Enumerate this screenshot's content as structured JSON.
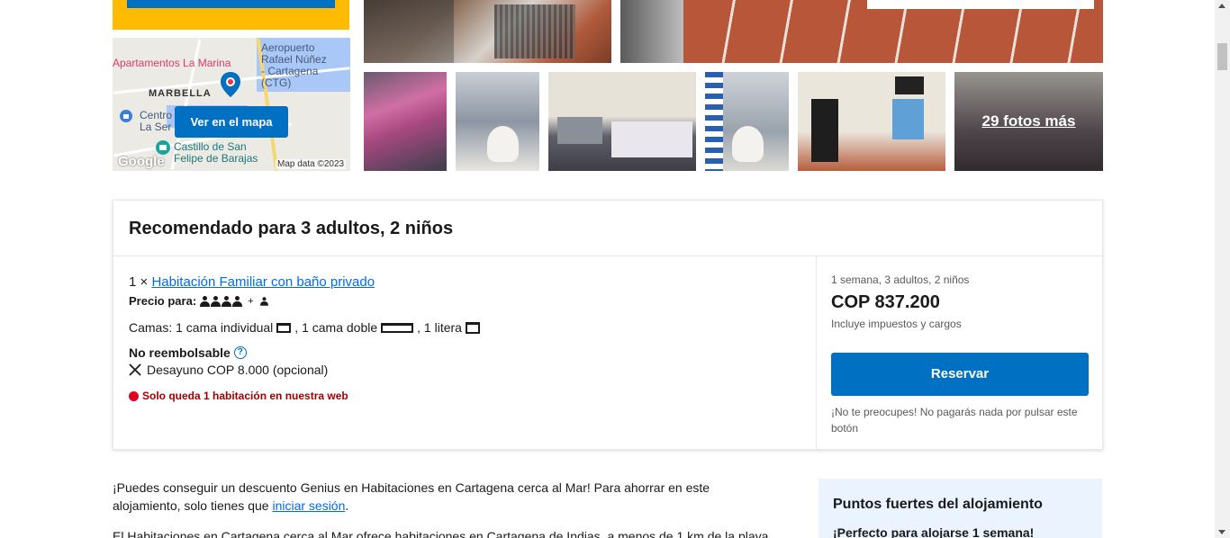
{
  "map": {
    "labels": {
      "hotel": "Apartamentos La Marina",
      "airport": "Aeropuerto\nRafael Núñez\n- Cartagena\n(CTG)",
      "marbella": "MARBELLA",
      "centro": "Centro\nLa Ser",
      "castillo": "Castillo de San\nFelipe de Barajas"
    },
    "button_label": "Ver en el mapa",
    "google": "Google",
    "map_data": "Map data ©2023"
  },
  "photos": {
    "more_label": "29 fotos más"
  },
  "recommendation": {
    "title": "Recomendado para 3 adultos, 2 niños",
    "room_count": "1 ×",
    "room_name": "Habitación Familiar con baño privado",
    "price_for_label": "Precio para:",
    "adults_icons": 4,
    "children_icons": 1,
    "beds_label": "Camas: 1 cama individual",
    "bed_double": ", 1 cama doble",
    "bed_bunk": ", 1 litera",
    "non_refundable": "No reembolsable",
    "breakfast": "Desayuno COP 8.000 (opcional)",
    "scarcity": "Solo queda 1 habitación en nuestra web",
    "stay_info": "1 semana, 3 adultos, 2 niños",
    "price": "COP 837.200",
    "taxes": "Incluye impuestos y cargos",
    "reserve_label": "Reservar",
    "dont_worry": "¡No te preocupes! No pagarás nada por pulsar este botón"
  },
  "description": {
    "line1_prefix": "¡Puedes conseguir un descuento Genius en Habitaciones en Cartagena cerca al Mar! Para ahorrar en este alojamiento, solo tienes que ",
    "login_link": "iniciar sesión",
    "line1_suffix": ".",
    "line2": "El Habitaciones en Cartagena cerca al Mar ofrece habitaciones en Cartagena de Indias, a menos de 1 km de la playa"
  },
  "highlights": {
    "title": "Puntos fuertes del alojamiento",
    "subtitle": "¡Perfecto para alojarse 1 semana!"
  },
  "colors": {
    "brand_blue": "#0071c2",
    "link_blue": "#006ce4",
    "yellow": "#febb02",
    "scarcity_red": "#a30000"
  }
}
